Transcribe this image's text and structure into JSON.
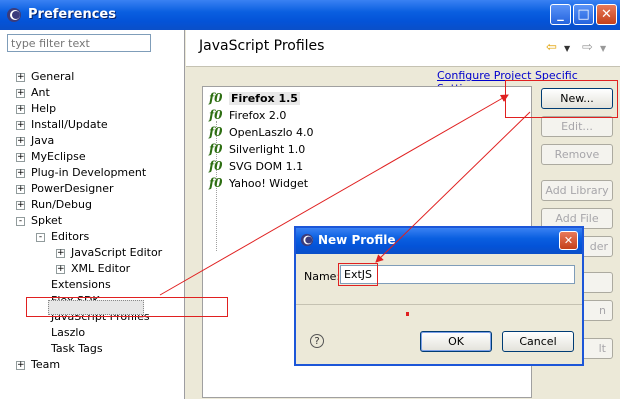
{
  "window": {
    "title": "Preferences",
    "icon": "eclipse-icon",
    "minimize": "_",
    "maximize": "□",
    "close": "✕"
  },
  "filter": {
    "placeholder": "type filter text"
  },
  "tree": [
    {
      "label": "General"
    },
    {
      "label": "Ant"
    },
    {
      "label": "Help"
    },
    {
      "label": "Install/Update"
    },
    {
      "label": "Java"
    },
    {
      "label": "MyEclipse"
    },
    {
      "label": "Plug-in Development"
    },
    {
      "label": "PowerDesigner"
    },
    {
      "label": "Run/Debug"
    },
    {
      "label": "Spket"
    },
    {
      "label": "Editors"
    },
    {
      "label": "JavaScript Editor"
    },
    {
      "label": "XML Editor"
    },
    {
      "label": "Extensions"
    },
    {
      "label": "Flex SDK"
    },
    {
      "label": "JavaScript Profiles"
    },
    {
      "label": "Laszlo"
    },
    {
      "label": "Task Tags"
    },
    {
      "label": "Team"
    }
  ],
  "page": {
    "title": "JavaScript Profiles",
    "configure_link": "Configure Project Specific Settings..."
  },
  "profiles": [
    {
      "label": "Firefox 1.5"
    },
    {
      "label": "Firefox 2.0"
    },
    {
      "label": "OpenLaszlo 4.0"
    },
    {
      "label": "Silverlight 1.0"
    },
    {
      "label": "SVG DOM 1.1"
    },
    {
      "label": "Yahoo! Widget"
    }
  ],
  "profile_icon": "f0",
  "buttons": {
    "new": "New...",
    "edit": "Edit...",
    "remove": "Remove",
    "add_library": "Add Library",
    "add_file": "Add File",
    "partial_1": "der",
    "partial_2": "n",
    "partial_3": "lt"
  },
  "dialog": {
    "title": "New Profile",
    "name_label": "Name:",
    "name_value": "ExtJS",
    "ok": "OK",
    "cancel": "Cancel",
    "help": "?"
  },
  "colors": {
    "annotation": "#e02020",
    "titlebar": "#0a5fe0"
  }
}
